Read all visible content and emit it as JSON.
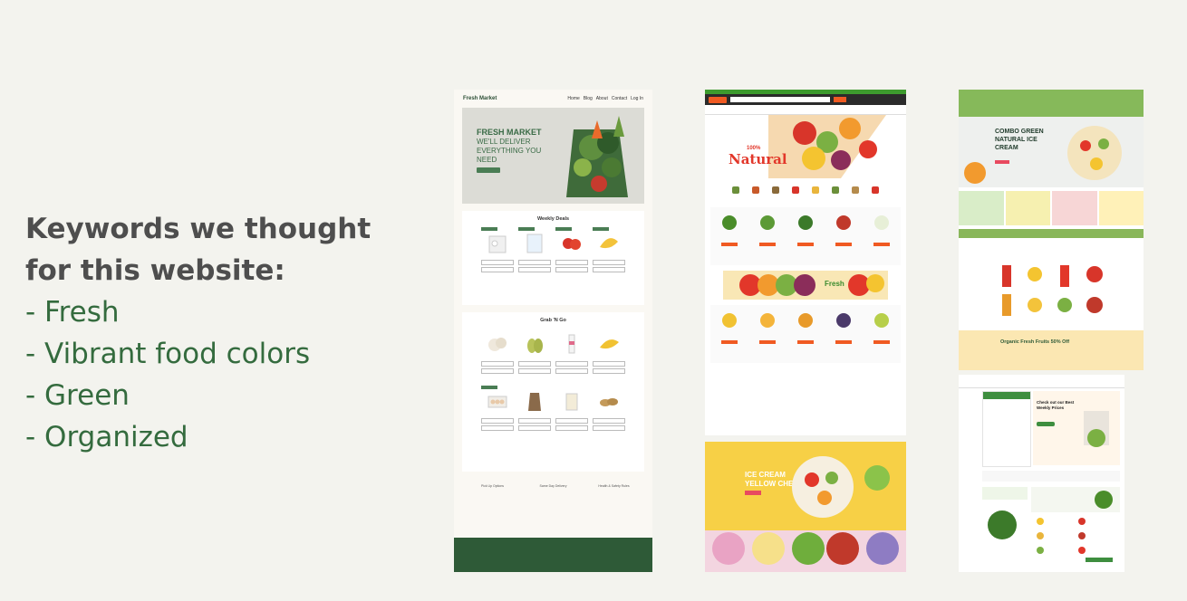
{
  "panel": {
    "heading_line1": "Keywords we thought",
    "heading_line2": "for this website:",
    "keywords": [
      "- Fresh",
      "- Vibrant food colors",
      "- Green",
      "- Organized"
    ]
  },
  "colors": {
    "background": "#f3f3ee",
    "heading": "#4e4e4e",
    "keyword": "#346b3e"
  },
  "shot1": {
    "logo": "Fresh Market",
    "nav": [
      "Home",
      "Blog",
      "About",
      "Contact",
      "Log In"
    ],
    "hero_line1": "FRESH MARKET",
    "hero_line2": "WE'LL DELIVER EVERYTHING YOU NEED",
    "section1": "Weekly Deals",
    "section2": "Grab 'N Go",
    "features": [
      "Pick Up Options",
      "Same Day Delivery",
      "Health & Safety Rules"
    ]
  },
  "shot2": {
    "hero_pct": "100%",
    "hero_word": "Natural",
    "banner_word": "Fresh"
  },
  "shot3": {
    "hero": "ICE CREAM YELLOW CHERRY"
  },
  "shot4": {
    "hero": "COMBO GREEN NATURAL ICE CREAM",
    "promo": "Organic Fresh Fruits 50% Off"
  },
  "shot5": {
    "hero": "Check out our Best Weekly Prices"
  }
}
